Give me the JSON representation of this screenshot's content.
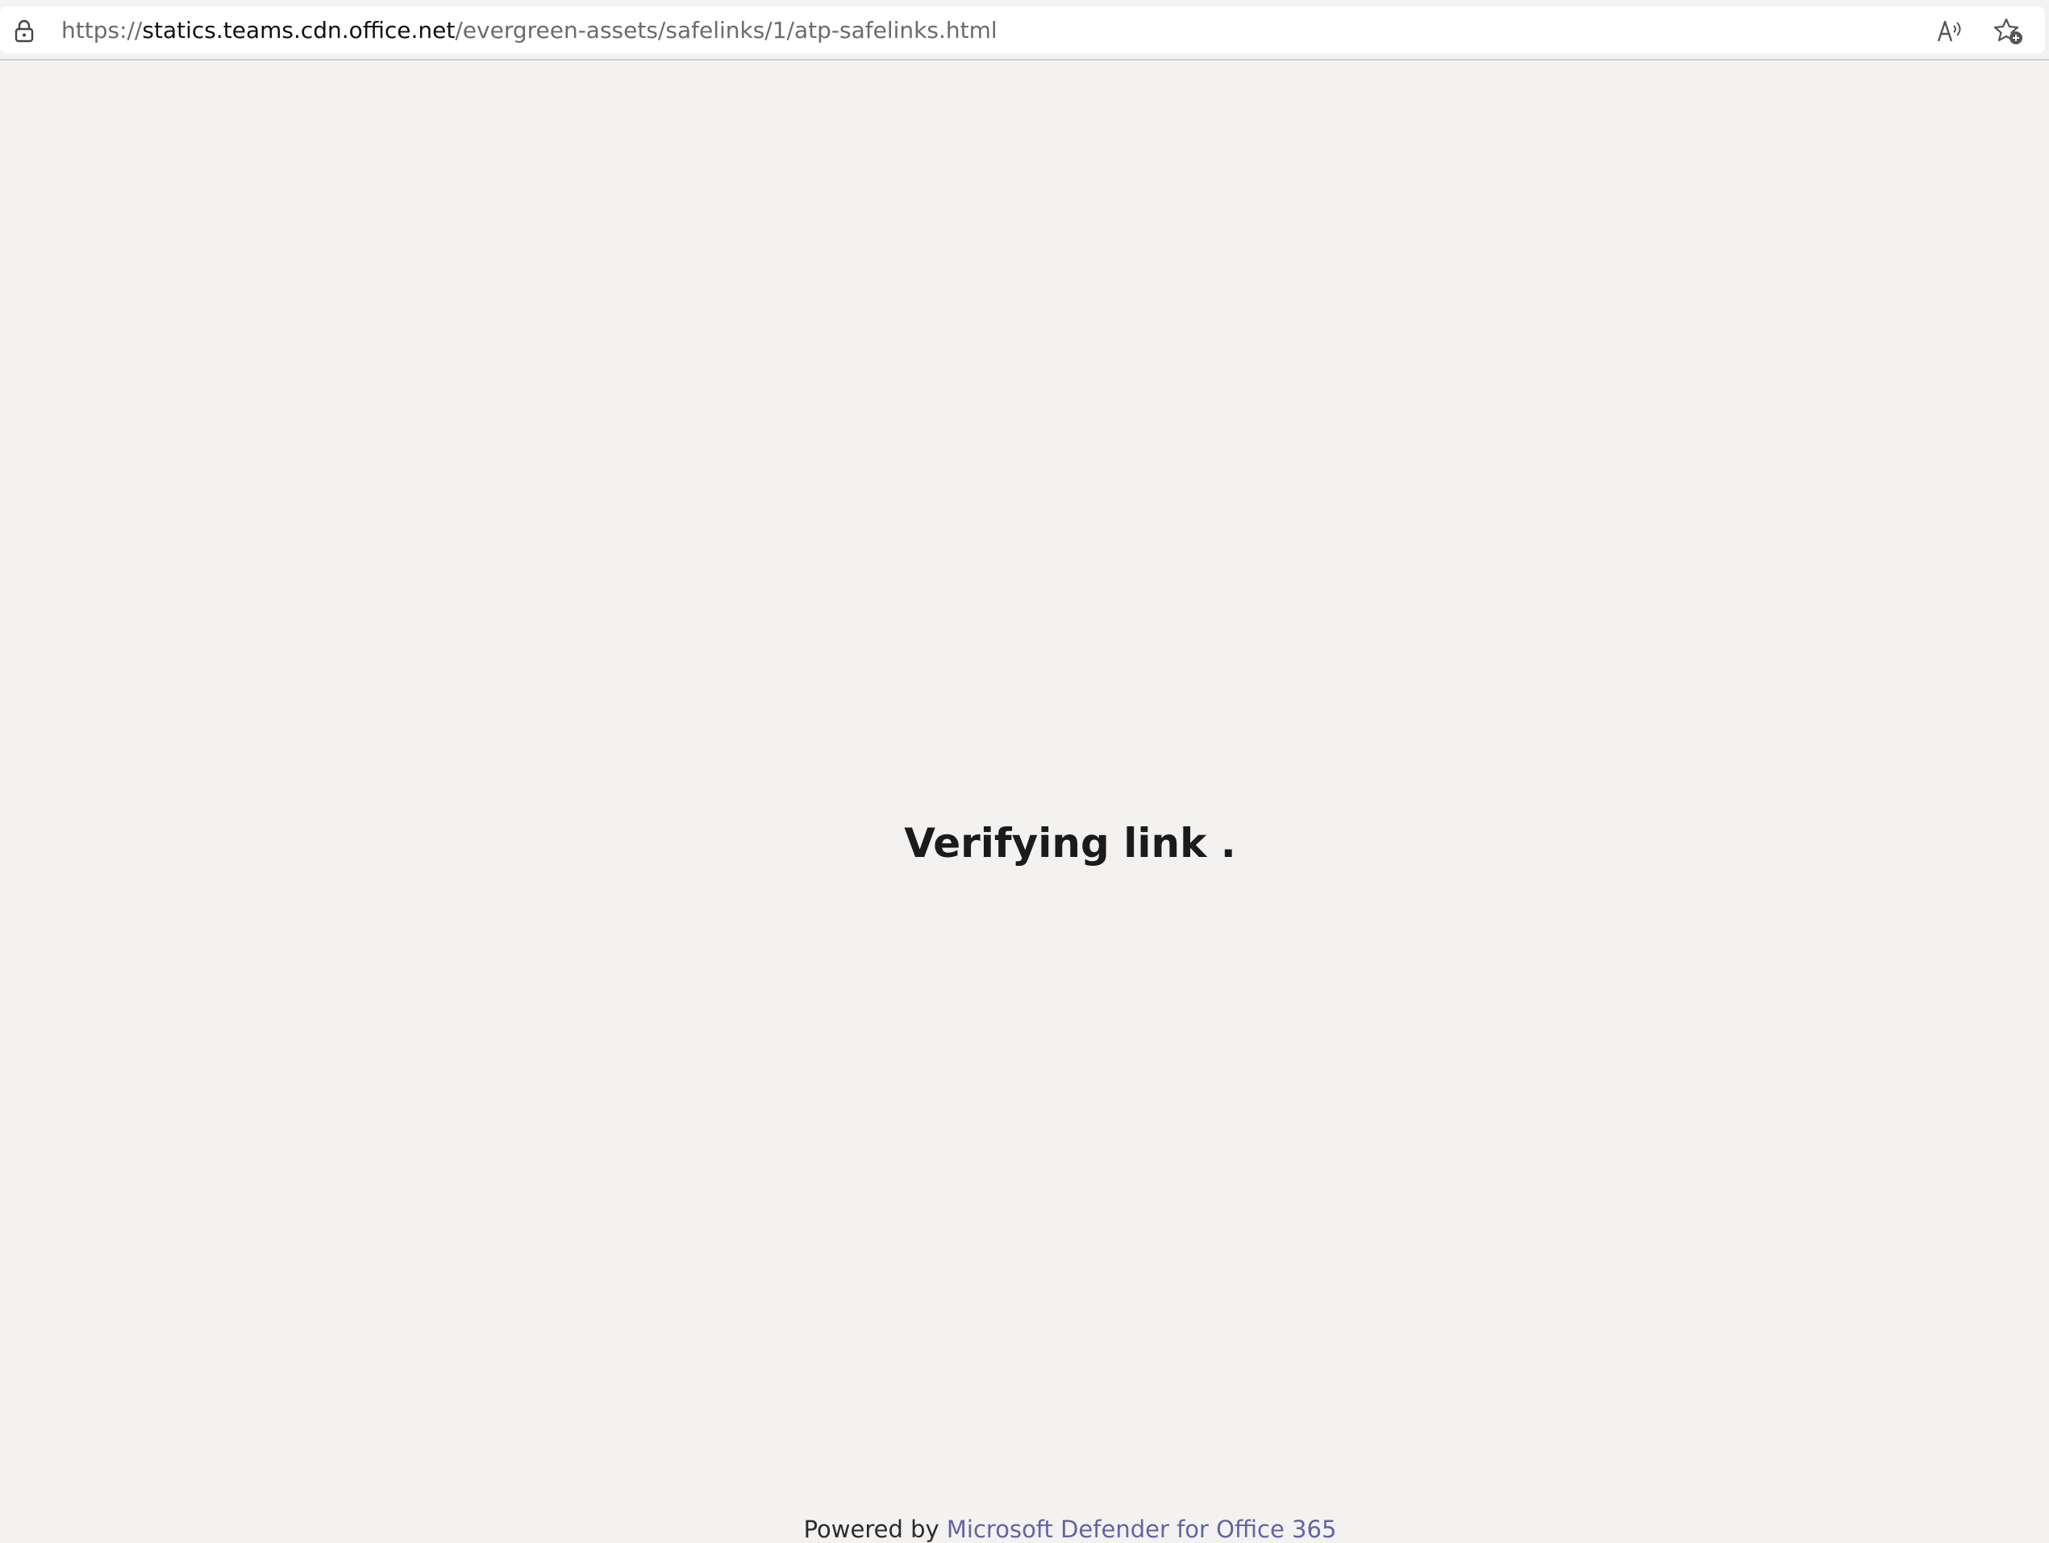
{
  "browser": {
    "url_scheme": "https://",
    "url_host": "statics.teams.cdn.office.net",
    "url_path": "/evergreen-assets/safelinks/1/atp-safelinks.html",
    "icons": {
      "lock": "lock-icon",
      "read_aloud": "read-aloud-icon",
      "favorites": "add-favorite-icon"
    }
  },
  "main": {
    "status": "Verifying link ."
  },
  "footer": {
    "prefix": "Powered by ",
    "link_label": "Microsoft Defender for Office 365"
  },
  "colors": {
    "page_background": "#f3f2f1",
    "link": "#6264a7",
    "text": "#1b1b1b"
  }
}
